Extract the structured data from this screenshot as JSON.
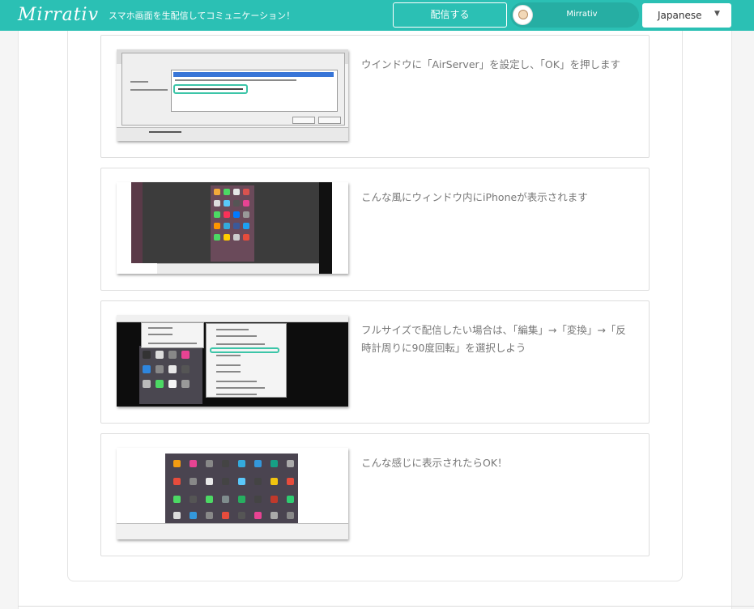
{
  "header": {
    "logo": "Mirrativ",
    "tagline": "スマホ画面を生配信してコミュニケーション！",
    "stream_button": "配信する",
    "user_name": "Mirrativ",
    "language": "Japanese",
    "colors": {
      "brand": "#2bc0b4",
      "highlight": "#3cc5a8"
    }
  },
  "steps": [
    {
      "text": "ウインドウに「AirServer」を設定し、「OK」を押します",
      "screenshot": "window-settings-dialog"
    },
    {
      "text": "こんな風にウィンドウ内にiPhoneが表示されます",
      "screenshot": "iphone-in-window"
    },
    {
      "text": "フルサイズで配信したい場合は、「編集」→「変換」→「反時計周りに90度回転」を選択しよう",
      "screenshot": "rotate-menu"
    },
    {
      "text": "こんな感じに表示されたらOK！",
      "screenshot": "final-display"
    }
  ]
}
